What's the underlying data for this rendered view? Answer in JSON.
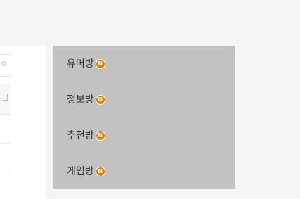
{
  "menu": {
    "items": [
      {
        "label": "유머방",
        "badge": "N"
      },
      {
        "label": "정보방",
        "badge": "N"
      },
      {
        "label": "추천방",
        "badge": "N"
      },
      {
        "label": "게임방",
        "badge": "N"
      }
    ]
  },
  "icons": {
    "left_search": "search-icon",
    "left_tab": "tab-marker-icon",
    "badge": "new-badge-icon"
  },
  "colors": {
    "page_background": "#f5f5f5",
    "menu_background": "#c2c2c2",
    "menu_text": "#333333",
    "badge": "#f17d00"
  }
}
